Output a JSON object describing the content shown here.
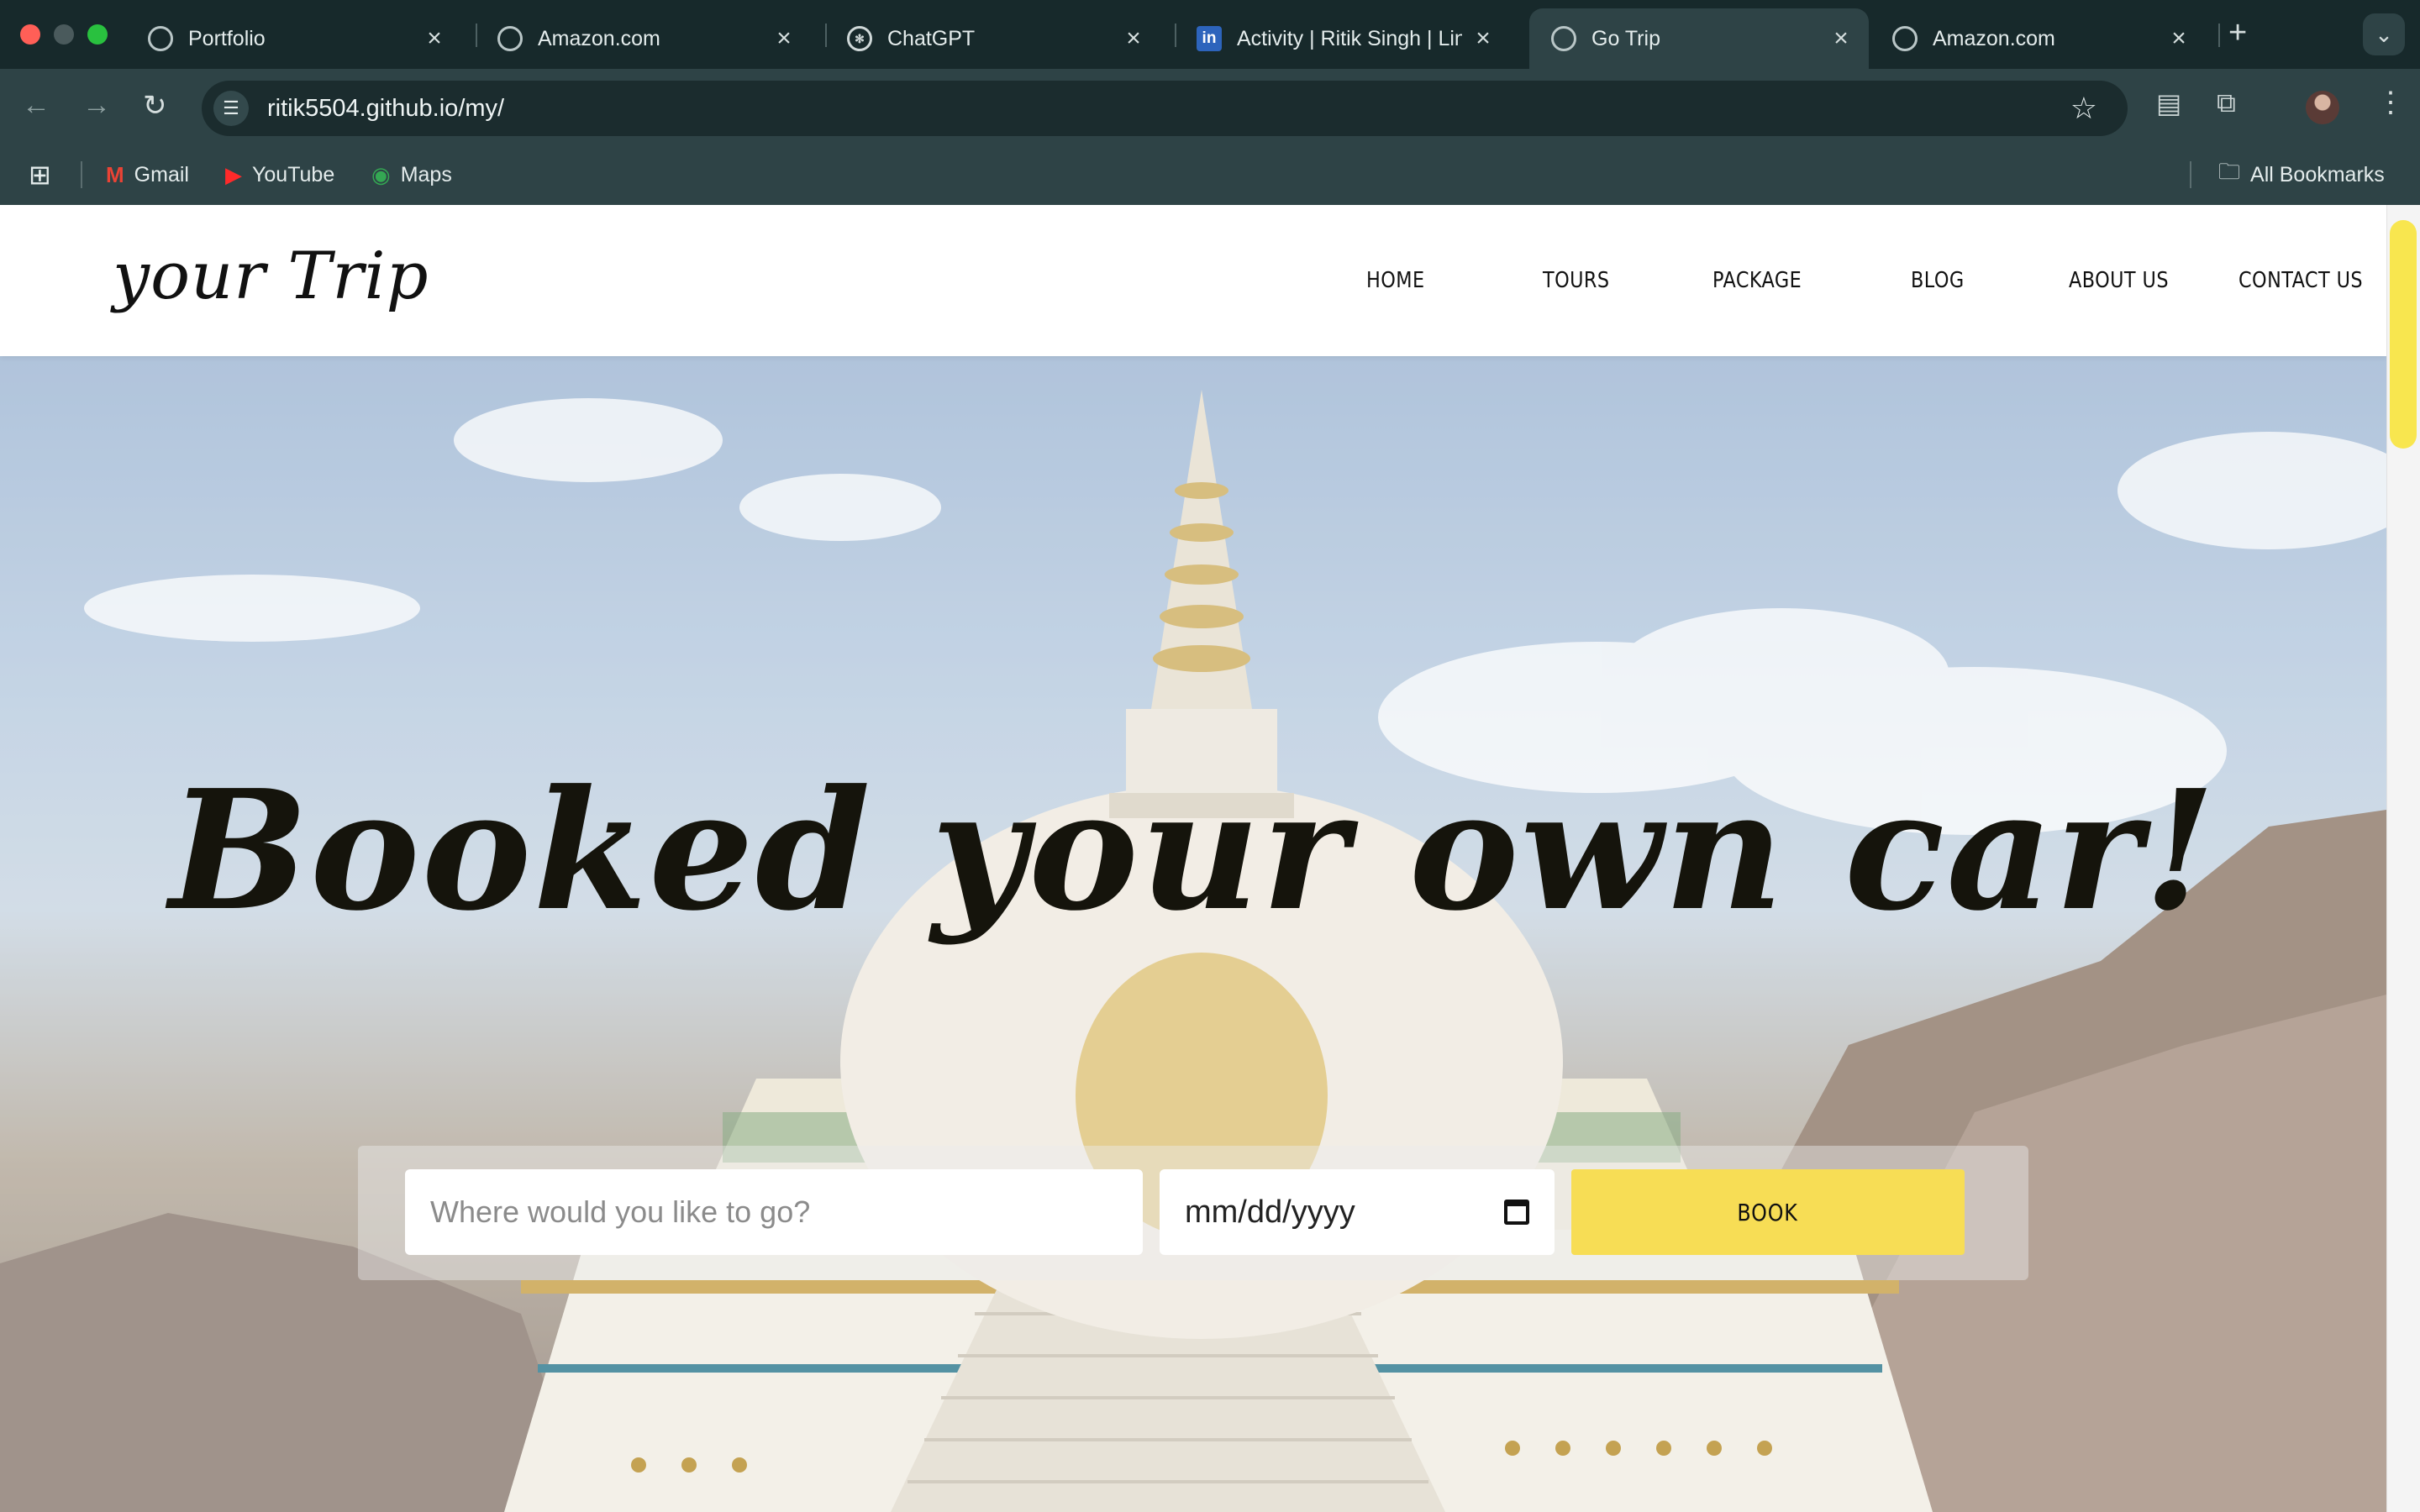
{
  "browser": {
    "tabs": [
      {
        "title": "Portfolio",
        "icon": "globe-icon",
        "active": false
      },
      {
        "title": "Amazon.com",
        "icon": "globe-icon",
        "active": false
      },
      {
        "title": "ChatGPT",
        "icon": "chatgpt-icon",
        "active": false
      },
      {
        "title": "Activity | Ritik Singh | Lin",
        "icon": "linkedin-icon",
        "active": false
      },
      {
        "title": "Go Trip",
        "icon": "globe-icon",
        "active": true
      },
      {
        "title": "Amazon.com",
        "icon": "globe-icon",
        "active": false
      }
    ],
    "url": "ritik5504.github.io/my/",
    "bookmarks": [
      {
        "label": "Gmail",
        "icon": "gmail-icon"
      },
      {
        "label": "YouTube",
        "icon": "youtube-icon"
      },
      {
        "label": "Maps",
        "icon": "maps-icon"
      }
    ],
    "all_bookmarks_label": "All Bookmarks"
  },
  "site": {
    "logo": "your Trip",
    "nav": [
      "HOME",
      "TOURS",
      "PACKAGE",
      "BLOG",
      "ABOUT US",
      "CONTACT US"
    ],
    "hero_title": "Booked your own car!",
    "destination_placeholder": "Where would you like to go?",
    "date_placeholder": "mm/dd/yyyy",
    "book_label": "BOOK",
    "accent_color": "#f7dd55"
  }
}
